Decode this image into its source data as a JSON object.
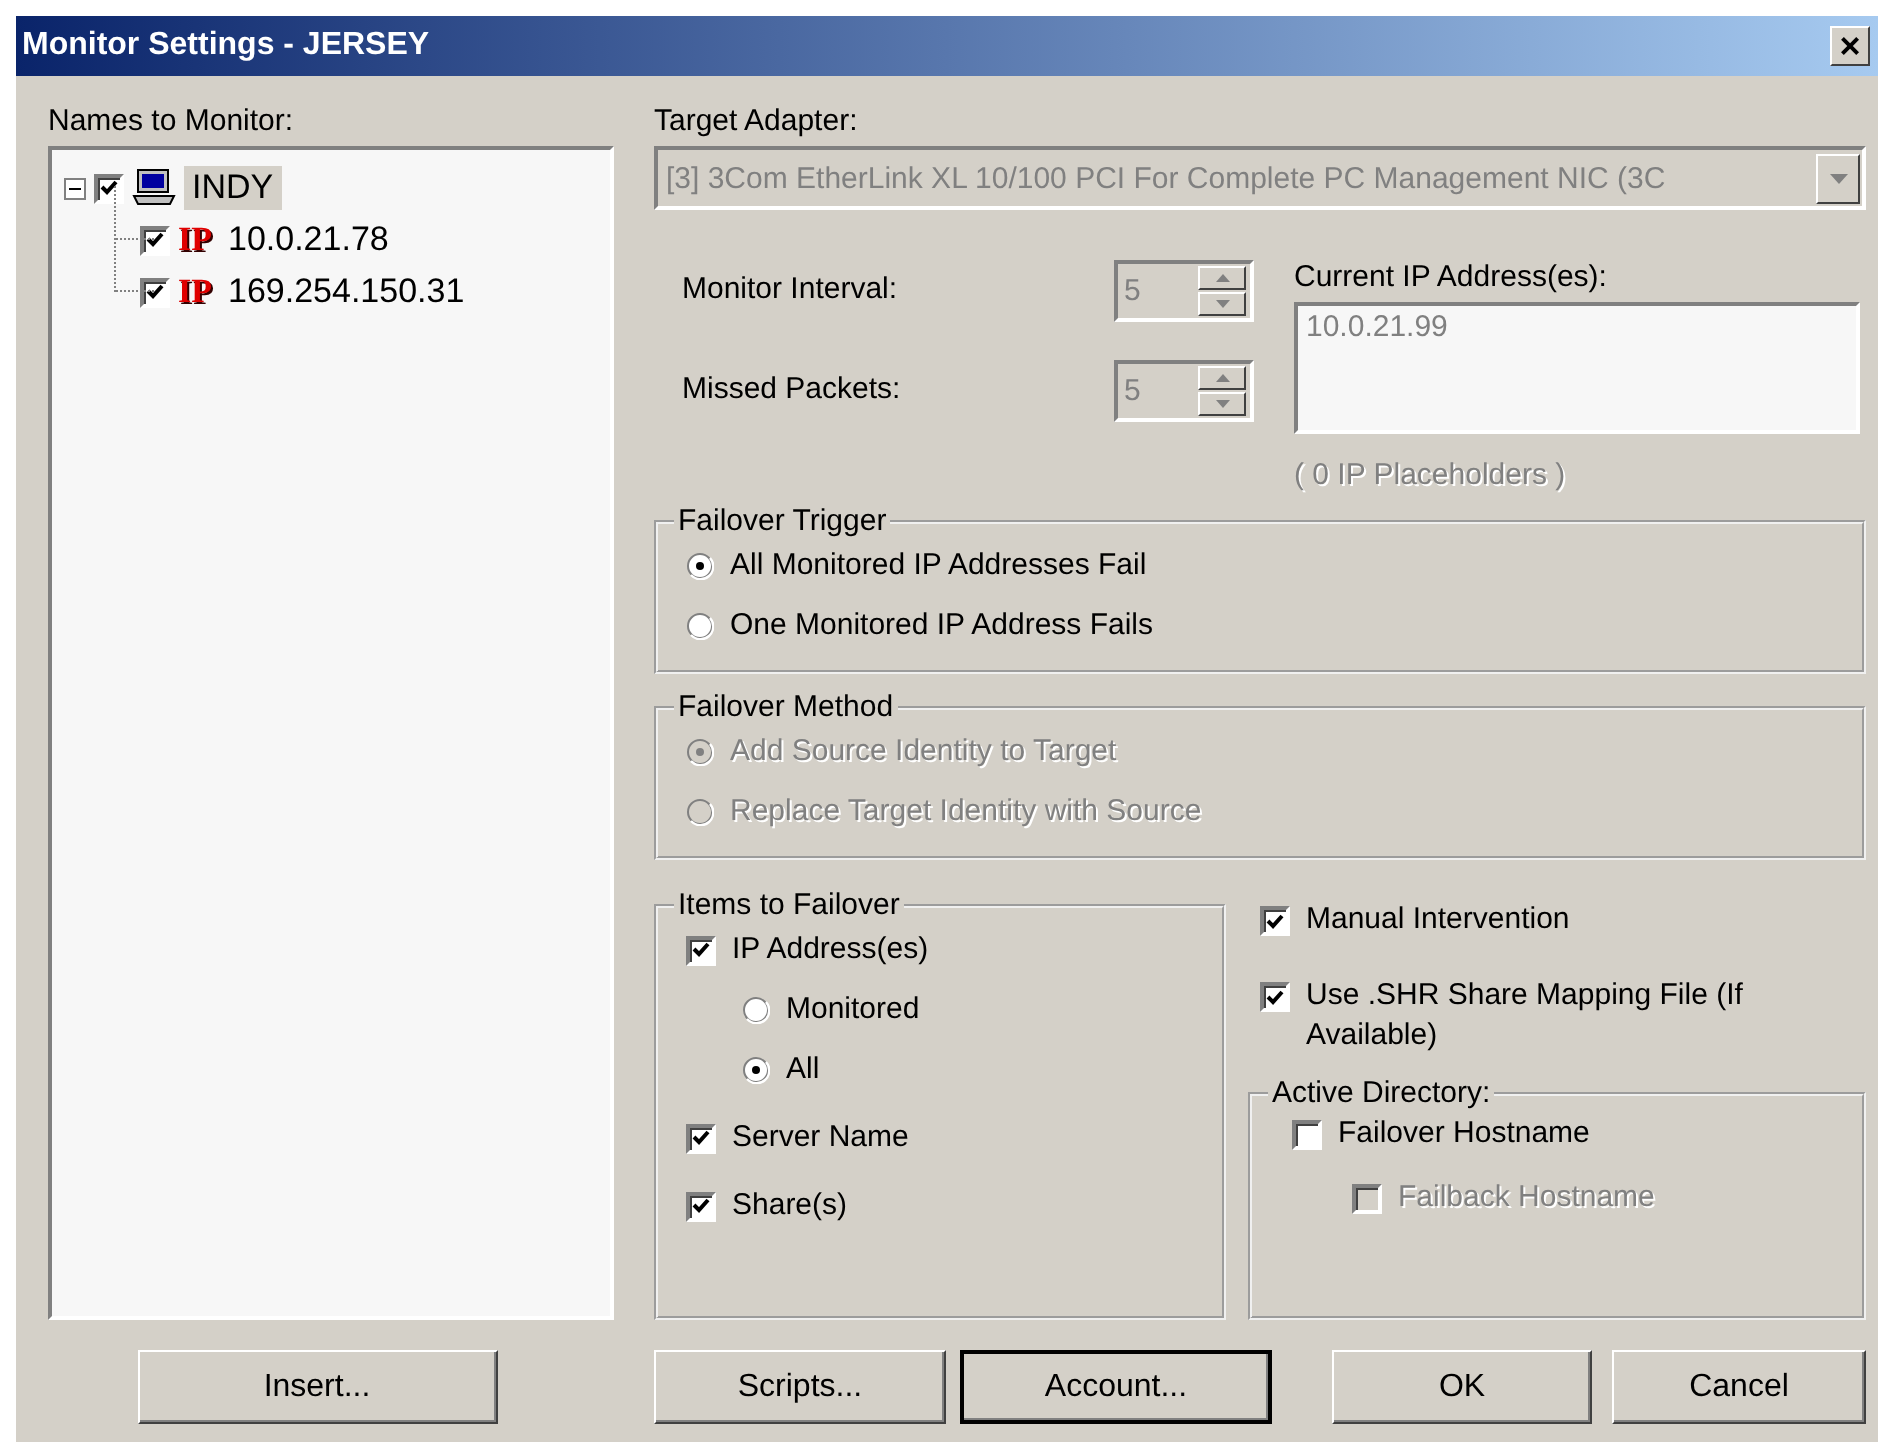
{
  "window": {
    "title": "Monitor Settings - JERSEY",
    "close": "×"
  },
  "names_to_monitor": {
    "label": "Names to Monitor:",
    "tree": [
      {
        "kind": "computer",
        "label": "INDY",
        "checked": true,
        "selected": true,
        "expanded": true,
        "children": [
          {
            "kind": "ip",
            "badge": "IP",
            "label": "10.0.21.78",
            "checked": true,
            "selected": false
          },
          {
            "kind": "ip",
            "badge": "IP",
            "label": "169.254.150.31",
            "checked": true,
            "selected": false
          }
        ]
      }
    ]
  },
  "target_adapter": {
    "label": "Target Adapter:",
    "value": "[3] 3Com EtherLink XL 10/100 PCI For Complete PC Management NIC (3C",
    "disabled": true
  },
  "spinners": [
    {
      "label": "Monitor Interval:",
      "value": "5",
      "disabled": true
    },
    {
      "label": "Missed Packets:",
      "value": "5",
      "disabled": true
    }
  ],
  "current_ip": {
    "label": "Current IP Address(es):",
    "value": "10.0.21.99",
    "note": "( 0 IP Placeholders )"
  },
  "failover_trigger": {
    "title": "Failover Trigger",
    "options": [
      {
        "label": "All Monitored IP Addresses Fail",
        "selected": true,
        "disabled": false
      },
      {
        "label": "One Monitored IP Address Fails",
        "selected": false,
        "disabled": false
      }
    ]
  },
  "failover_method": {
    "title": "Failover Method",
    "options": [
      {
        "label": "Add Source Identity to Target",
        "selected": true,
        "disabled": true
      },
      {
        "label": "Replace Target Identity with Source",
        "selected": false,
        "disabled": true
      }
    ]
  },
  "items_to_failover": {
    "title": "Items to Failover",
    "items": [
      {
        "kind": "checkbox",
        "label": "IP Address(es)",
        "checked": true,
        "children": [
          {
            "kind": "radio",
            "label": "Monitored",
            "selected": false
          },
          {
            "kind": "radio",
            "label": "All",
            "selected": true
          }
        ]
      },
      {
        "kind": "checkbox",
        "label": "Server Name",
        "checked": true
      },
      {
        "kind": "checkbox",
        "label": "Share(s)",
        "checked": true
      }
    ]
  },
  "options": [
    {
      "label": "Manual Intervention",
      "checked": true
    },
    {
      "label": "Use .SHR Share Mapping File (If Available)",
      "checked": true
    }
  ],
  "active_directory": {
    "title": "Active Directory:",
    "items": [
      {
        "label": "Failover Hostname",
        "checked": false,
        "disabled": false,
        "children": [
          {
            "label": "Failback Hostname",
            "checked": false,
            "disabled": true
          }
        ]
      }
    ]
  },
  "insert_button": {
    "label": "Insert...",
    "default": false
  },
  "buttons": [
    {
      "label": "Scripts...",
      "default": false
    },
    {
      "label": "Account...",
      "default": true
    },
    {
      "label": "OK",
      "default": false
    },
    {
      "label": "Cancel",
      "default": false
    }
  ]
}
